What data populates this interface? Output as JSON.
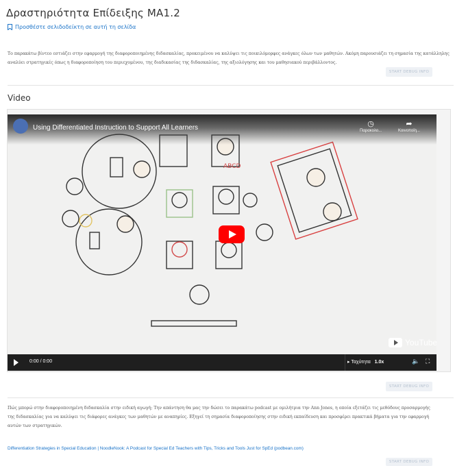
{
  "page": {
    "title": "Δραστηριότητα Επίδειξης MA1.2",
    "bookmark_label": "Προσθέστε σελιδοδείκτη σε αυτή τη σελίδα",
    "intro_lines": [
      "Το παρακάτω βίντεο εστιάζει στην εφαρμογή της διαφοροποιημένης διδασκαλίας, προκειμένου να καλύψει τις ποικιλόμορφες ανάγκες όλων των μαθητών. Ακόμη παρουσιάζει τη σημασία της κατάλληλης",
      "αναλύει στρατηγικές όπως η διαφοροποίηση του περιεχομένου, της διαδικασίας της διδασκαλίας, της αξιολόγησης και του μαθησιακού περιβάλλοντος."
    ],
    "debug_label": "START DEBUG INFO",
    "video_heading": "Video",
    "body_lines": [
      "Πώς μπορώ στην διαφοροποιημένη διδασκαλία στην ειδική αγωγή; Την απάντηση θα μας την δώσει το παρακάτω podcast με ομιλήτρια την Ann Jones, η οποία εξετάζει τις μεθόδους προσαρμογής",
      "της διδασκαλίας για να καλύψει τις διάφορες ανάγκες των μαθητών με αναπηρίες. Εξηγεί τη σημασία διαφοροποίησης στην ειδική εκπαίδευση και προσφέρει πρακτικά βήματα για την εφαρμογή",
      "αυτών των στρατηγικών."
    ],
    "link_text": "Differentiation Strategies in Special Education | NoodleNook: A Podcast for Special Ed Teachers with Tips, Tricks and Tools Just for SpEd (podbean.com)"
  },
  "video": {
    "title": "Using Differentiated Instruction to Support All Learners",
    "watch_later_label": "Παρακολο...",
    "share_label": "Κοινοποίη...",
    "time": "0:00 / 0:00",
    "speed_label": "Ταχύτητα",
    "speed_value": "1.0x",
    "youtube_label": "YouTube",
    "icons": {
      "watch_later": "clock-icon",
      "share": "share-arrow-icon",
      "volume": "speaker-icon",
      "fullscreen": "fullscreen-icon"
    }
  },
  "colors": {
    "link": "#1a73c8",
    "play_button": "#ff0000",
    "debug_bg": "#eef1f5"
  }
}
